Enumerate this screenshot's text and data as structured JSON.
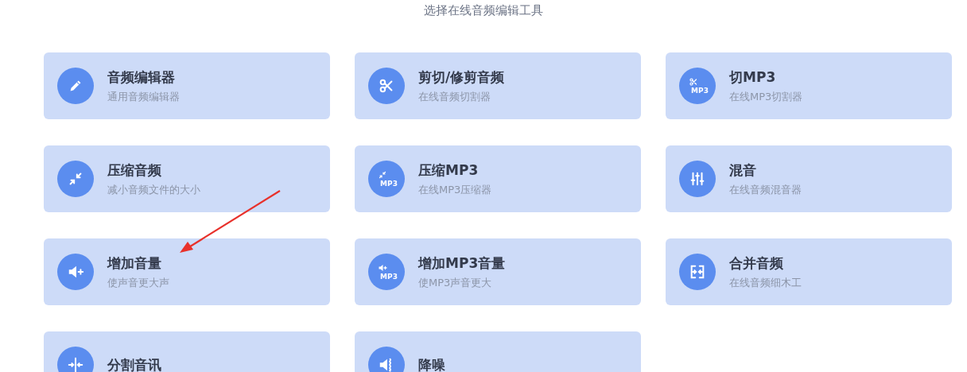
{
  "heading": "选择在线音频编辑工具",
  "tools": [
    {
      "title": "音频编辑器",
      "subtitle": "通用音频编辑器"
    },
    {
      "title": "剪切/修剪音频",
      "subtitle": "在线音频切割器"
    },
    {
      "title": "切MP3",
      "subtitle": "在线MP3切割器",
      "badge": "MP3"
    },
    {
      "title": "压缩音频",
      "subtitle": "减小音频文件的大小"
    },
    {
      "title": "压缩MP3",
      "subtitle": "在线MP3压缩器",
      "badge": "MP3"
    },
    {
      "title": "混音",
      "subtitle": "在线音频混音器"
    },
    {
      "title": "增加音量",
      "subtitle": "使声音更大声"
    },
    {
      "title": "增加MP3音量",
      "subtitle": "使MP3声音更大",
      "badge": "MP3"
    },
    {
      "title": "合并音频",
      "subtitle": "在线音频细木工"
    },
    {
      "title": "分割音讯"
    },
    {
      "title": "降噪"
    }
  ]
}
